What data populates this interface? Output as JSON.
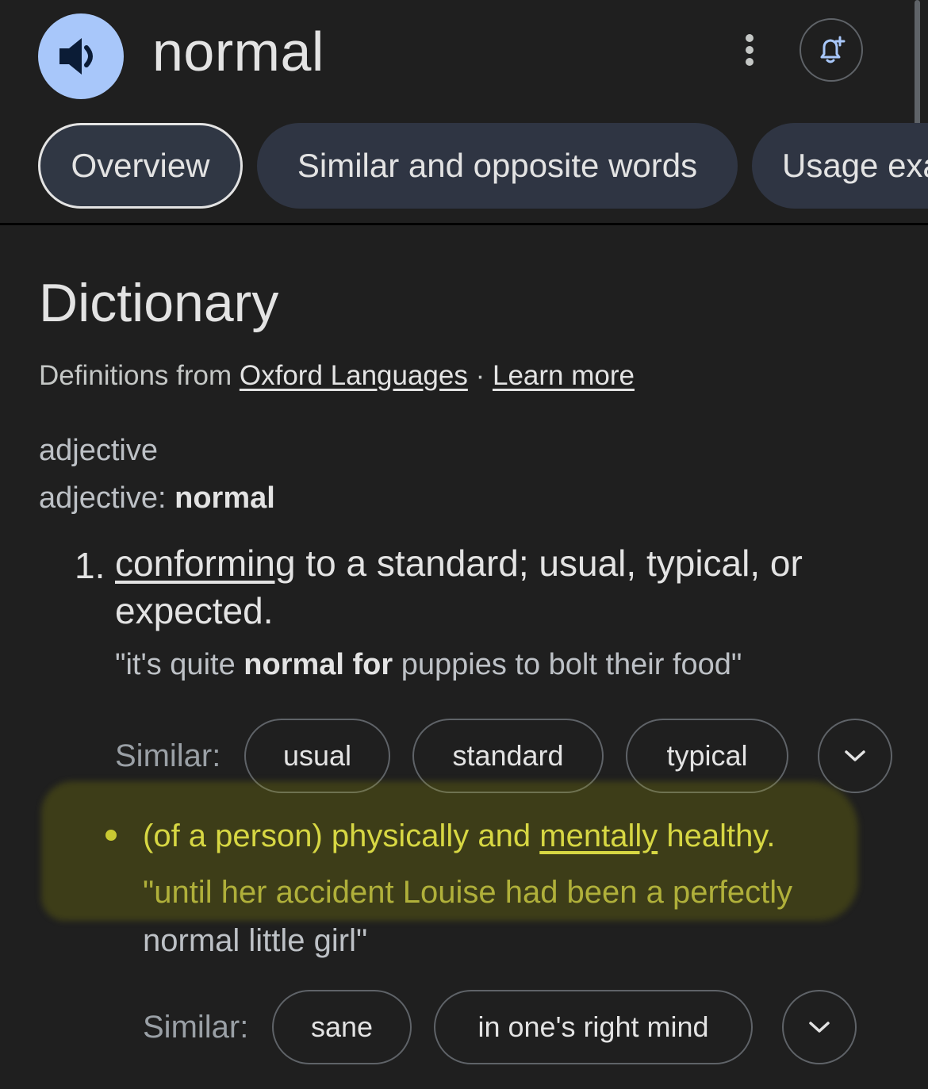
{
  "header": {
    "word": "normal",
    "speaker_icon": "volume-icon",
    "menu_icon": "more-vert-icon",
    "alert_icon": "bell-plus-icon"
  },
  "tabs": [
    {
      "label": "Overview",
      "active": true
    },
    {
      "label": "Similar and opposite words",
      "active": false
    },
    {
      "label": "Usage exa",
      "active": false
    }
  ],
  "dictionary": {
    "heading": "Dictionary",
    "source_prefix": "Definitions from",
    "source_link": "Oxford Languages",
    "separator": "·",
    "learn_more": "Learn more",
    "pos": "adjective",
    "pos_label": "adjective:",
    "pos_word": "normal"
  },
  "definitions": [
    {
      "number": "1.",
      "text_link": "conforming",
      "text_rest": " to a standard; usual, typical, or expected.",
      "example_open": "\"it's quite ",
      "example_bold": "normal for",
      "example_close": " puppies to bolt their food\"",
      "similar_label": "Similar:",
      "similar": [
        "usual",
        "standard",
        "typical"
      ]
    }
  ],
  "sub_sense": {
    "text_pre": "(of a person) physically and ",
    "text_link": "mentally",
    "text_post": " healthy.",
    "example_highlighted": "\"until her accident Louise had been a perfectly",
    "example_tail": "normal little girl\"",
    "similar_label": "Similar:",
    "similar": [
      "sane",
      "in one's right mind"
    ]
  },
  "colors": {
    "background": "#1f1f1f",
    "speaker_button": "#a8c7fa",
    "tab_bg": "#2f3543",
    "highlight": "#d7d743"
  }
}
